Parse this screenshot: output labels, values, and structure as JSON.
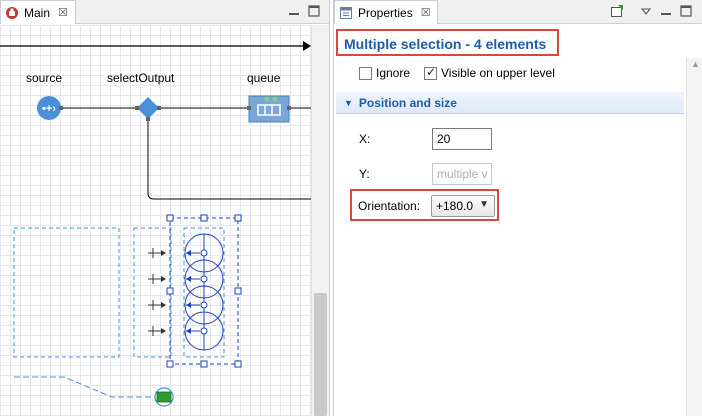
{
  "main_editor": {
    "tab_label": "Main",
    "tab_close": "☒",
    "blocks": [
      {
        "label": "source"
      },
      {
        "label": "selectOutput"
      },
      {
        "label": "queue"
      }
    ]
  },
  "properties": {
    "tab_label": "Properties",
    "tab_close": "☒",
    "title": "Multiple selection - 4 elements",
    "checkboxes": [
      {
        "label": "Ignore",
        "checked": false
      },
      {
        "label": "Visible on upper level",
        "checked": true
      }
    ],
    "section": {
      "arrow": "▼",
      "title": "Position and size"
    },
    "fields": {
      "x_label": "X:",
      "x_value": "20",
      "y_label": "Y:",
      "y_value": "multiple v",
      "orientation_label": "Orientation:",
      "orientation_value": "+180.0"
    }
  },
  "colors": {
    "accent": "#1a5ea8",
    "highlight_border": "#d9463a",
    "block_blue": "#4a90d9",
    "selection_blue": "#1f3fbf"
  }
}
